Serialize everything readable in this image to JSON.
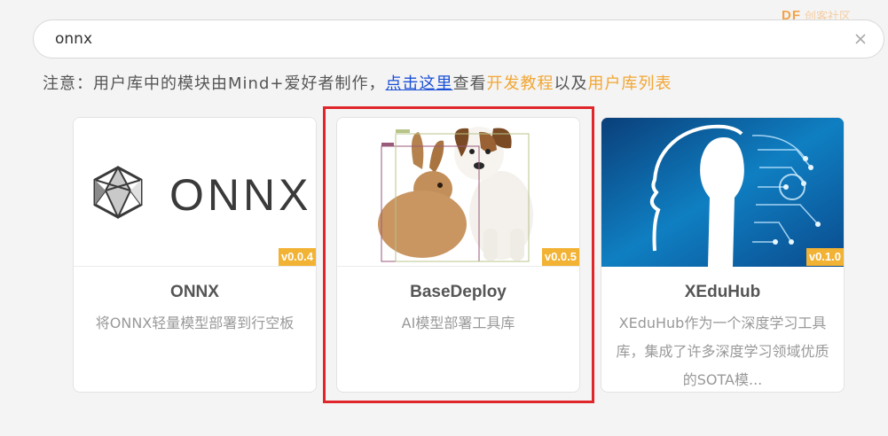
{
  "watermark": {
    "mark": "DF",
    "text": "创客社区"
  },
  "search": {
    "value": "onnx",
    "placeholder": ""
  },
  "notice": {
    "prefix": "注意：用户库中的模块由Mind+爱好者制作，",
    "link": "点击这里",
    "middle": "查看",
    "tutorial": "开发教程",
    "and": "以及",
    "user_library": "用户库列表"
  },
  "cards": [
    {
      "title": "ONNX",
      "version": "v0.0.4",
      "desc": "将ONNX轻量模型部署到行空板",
      "logo_text": "ONNX",
      "icon": "onnx-logo-icon"
    },
    {
      "title": "BaseDeploy",
      "version": "v0.0.5",
      "desc": "AI模型部署工具库",
      "icon": "rabbit-dog-detection-image"
    },
    {
      "title": "XEduHub",
      "version": "v0.1.0",
      "desc": "XEduHub作为一个深度学习工具库，集成了许多深度学习领域优质的SOTA模...",
      "icon": "ai-head-image"
    }
  ],
  "colors": {
    "link": "#1a4fd6",
    "accent_orange": "#f2a633",
    "badge": "#f2b233",
    "selection": "#e0262b"
  }
}
